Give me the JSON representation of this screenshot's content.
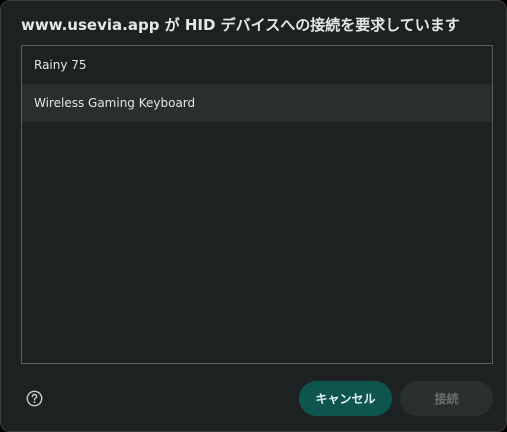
{
  "dialog": {
    "title": "www.usevia.app が HID デバイスへの接続を要求しています"
  },
  "devices": [
    {
      "name": "Rainy 75",
      "selected": false
    },
    {
      "name": "Wireless Gaming Keyboard",
      "selected": true
    }
  ],
  "footer": {
    "help_icon": "question-circle-icon",
    "cancel_label": "キャンセル",
    "connect_label": "接続",
    "connect_disabled": true
  },
  "colors": {
    "dialog_bg": "#1d2121",
    "accent_button": "#0e5550",
    "disabled_button": "#2b2f2f",
    "selected_row": "#2a2e2e"
  }
}
